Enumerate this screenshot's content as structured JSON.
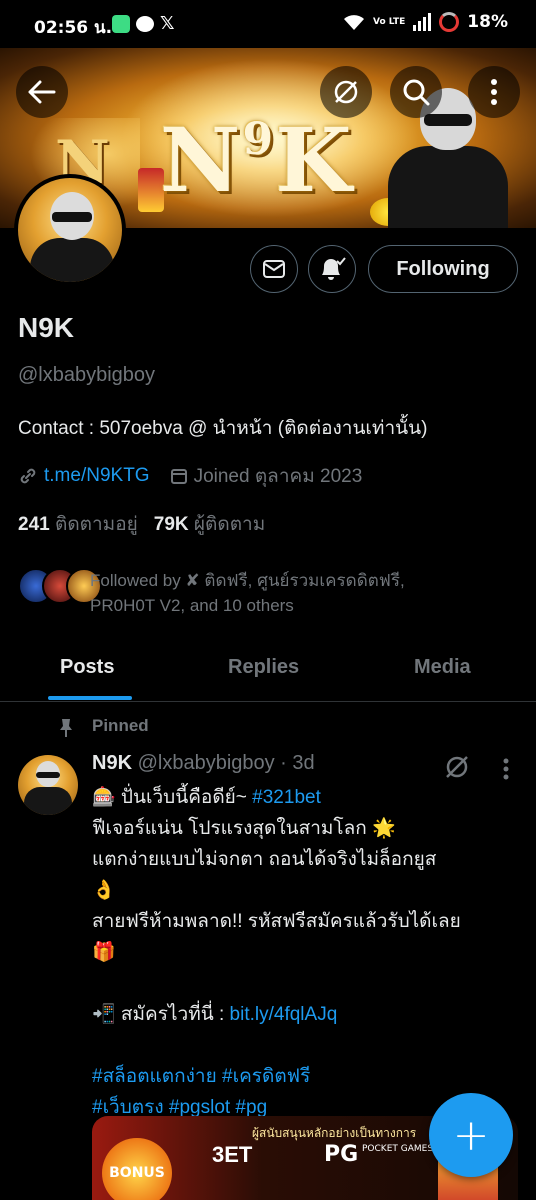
{
  "status_bar": {
    "time": "02:56 น.",
    "network": "Vo LTE",
    "battery": "18%"
  },
  "profile": {
    "banner_logo_main": "N",
    "banner_logo_sup": "9",
    "banner_logo_tail": "K",
    "name": "N9K",
    "handle": "@lxbabybigboy",
    "bio": "Contact : 507oebva @ นำหน้า (ติดต่องานเท่านั้น)",
    "link": "t.me/N9KTG",
    "joined": "Joined ตุลาคม 2023",
    "following_count": "241",
    "following_label": "ติดตามอยู่",
    "followers_count": "79K",
    "followers_label": "ผู้ติดตาม",
    "followed_by_line1": "Followed by ✘ ติดฟรี, ศูนย์รวมเครดดิตฟรี,",
    "followed_by_line2": "PR0H0T V2, and 10 others",
    "following_button": "Following"
  },
  "tabs": [
    {
      "label": "Posts",
      "active": true
    },
    {
      "label": "Replies",
      "active": false
    },
    {
      "label": "Media",
      "active": false
    }
  ],
  "post": {
    "pinned_label": "Pinned",
    "author_name": "N9K",
    "author_meta": "@lxbabybigboy · 3d",
    "line1_prefix": "🎰 ปั่นเว็บนี้คือดีย์~ ",
    "line1_tag": "#321bet",
    "line2": "ฟีเจอร์แน่น โปรแรงสุดในสามโลก 🌟",
    "line3": "แตกง่ายแบบไม่จกตา ถอนได้จริงไม่ล็อกยูส",
    "line4": "👌",
    "line5": "สายฟรีห้ามพลาด!! รหัสฟรีสมัครแล้วรับได้เลย",
    "line6": "🎁",
    "line7_prefix": "📲 สมัครไวที่นี่ : ",
    "line7_link": "bit.ly/4fqlAJq",
    "hashtags1": "#สล็อตแตกง่าย #เครดิตฟรี",
    "hashtags2": "#เว็บตรง #pgslot #pg"
  },
  "media": {
    "bonus_text": "BONUS",
    "sponsor_text": "ผู้สนับสนุนหลักอย่างเป็นทางการ",
    "brand": "3ET",
    "pg": "PG",
    "pg_sub": "POCKET GAMES SOFT"
  },
  "fab_label": "+",
  "colors": {
    "accent": "#1d9bf0",
    "muted": "#71767b",
    "text": "#e7e9ea",
    "background": "#000000"
  }
}
